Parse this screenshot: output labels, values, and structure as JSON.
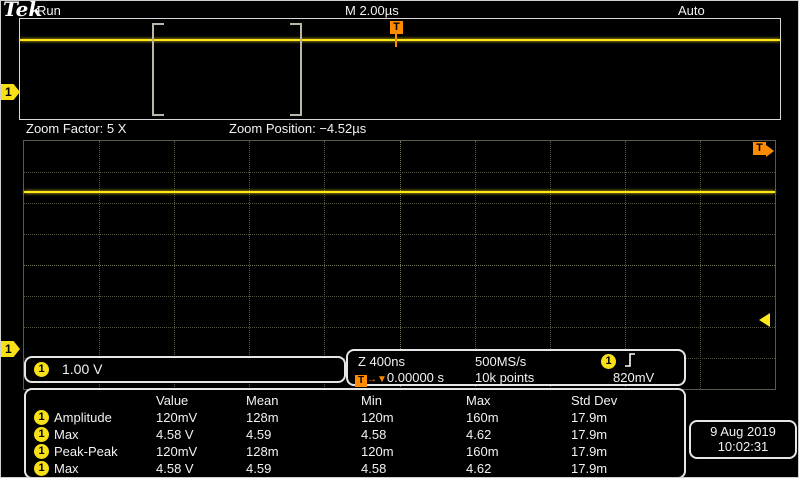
{
  "header": {
    "logo": "Tek",
    "acq_state": "Run",
    "horizontal_scale": "M 2.00µs",
    "trigger_mode": "Auto",
    "trigger_flag": "T"
  },
  "channel": {
    "number": "1"
  },
  "zoom": {
    "factor_label": "Zoom Factor: 5 X",
    "position_label": "Zoom Position: −4.52µs"
  },
  "readouts": {
    "ch1_scale": "1.00 V",
    "zoom_timebase": "Z 400ns",
    "sample_rate": "500MS/s",
    "record_length": "10k points",
    "trigger_position": "0.00000 s",
    "trigger_level": "820mV"
  },
  "icons": {
    "arrow_right": "→",
    "arrow_down": "▼"
  },
  "measurements": {
    "headers": {
      "value": "Value",
      "mean": "Mean",
      "min": "Min",
      "max": "Max",
      "stddev": "Std Dev"
    },
    "rows": [
      {
        "ch": "1",
        "name": "Amplitude",
        "value": "120mV",
        "mean": "128m",
        "min": "120m",
        "max": "160m",
        "stddev": "17.9m"
      },
      {
        "ch": "1",
        "name": "Max",
        "value": "4.58 V",
        "mean": "4.59",
        "min": "4.58",
        "max": "4.62",
        "stddev": "17.9m"
      },
      {
        "ch": "1",
        "name": "Peak-Peak",
        "value": "120mV",
        "mean": "128m",
        "min": "120m",
        "max": "160m",
        "stddev": "17.9m"
      },
      {
        "ch": "1",
        "name": "Max",
        "value": "4.58 V",
        "mean": "4.59",
        "min": "4.58",
        "max": "4.62",
        "stddev": "17.9m"
      }
    ]
  },
  "datetime": {
    "date": "9 Aug 2019",
    "time": "10:02:31"
  }
}
